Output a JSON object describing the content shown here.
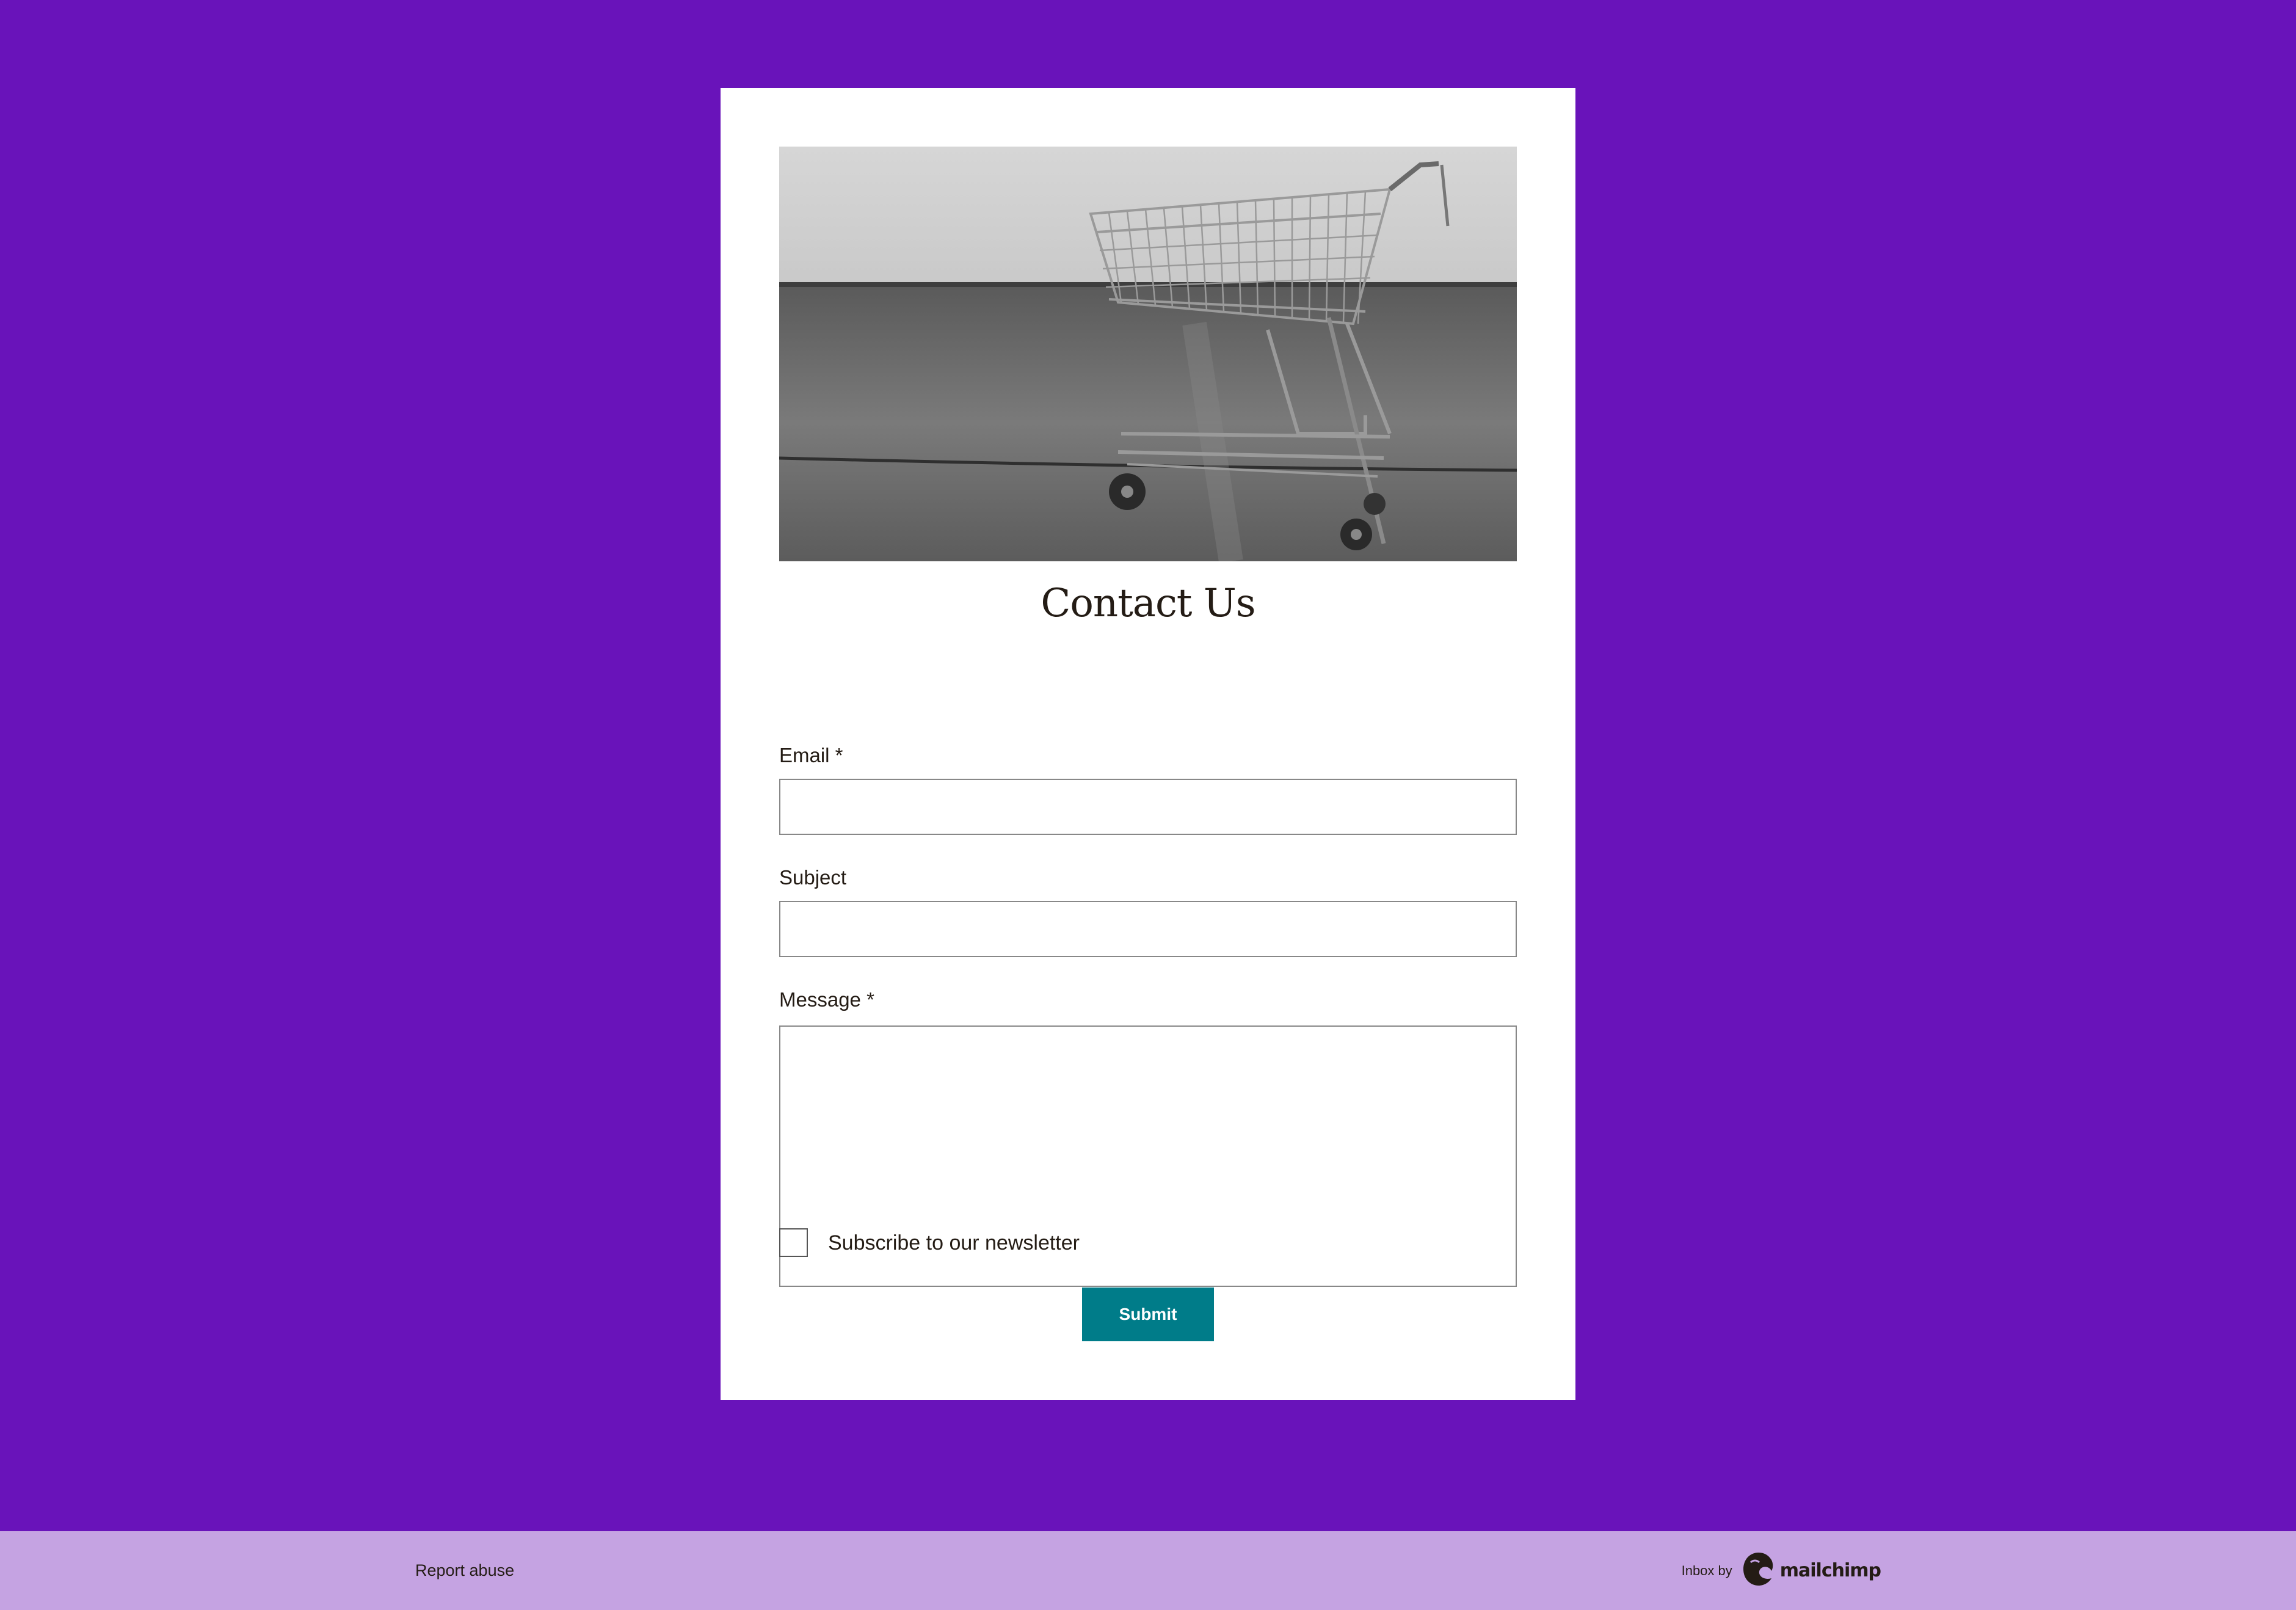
{
  "form": {
    "title": "Contact Us",
    "fields": [
      {
        "label": "Email *",
        "value": "",
        "type": "input"
      },
      {
        "label": "Subject",
        "value": "",
        "type": "input"
      },
      {
        "label": "Message *",
        "value": "",
        "type": "textarea"
      }
    ],
    "checkbox": {
      "label": "Subscribe to our newsletter",
      "checked": false
    },
    "submit_label": "Submit",
    "submit_color": "#007C89"
  },
  "hero_image": {
    "icon": "shopping-cart-photo"
  },
  "footer": {
    "report_label": "Report abuse",
    "inbox_by": "Inbox by",
    "brand_name": "mailchimp",
    "brand_icon": "mailchimp-freddie-icon"
  },
  "colors": {
    "page_background": "#6913BA",
    "footer_background": "#C5A3E2",
    "card_background": "#FFFFFF"
  }
}
